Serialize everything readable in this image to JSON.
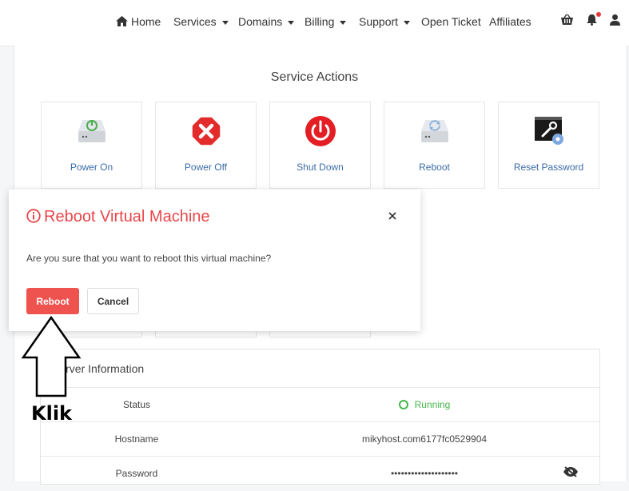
{
  "nav": {
    "home": "Home",
    "services": "Services",
    "domains": "Domains",
    "billing": "Billing",
    "support": "Support",
    "open_ticket": "Open Ticket",
    "affiliates": "Affiliates",
    "icons": [
      "home-icon",
      "basket-icon",
      "bell-icon",
      "user-icon"
    ]
  },
  "service_actions": {
    "title": "Service Actions",
    "items": [
      {
        "label": "Power On",
        "icon": "power-on-icon"
      },
      {
        "label": "Power Off",
        "icon": "power-off-icon"
      },
      {
        "label": "Shut Down",
        "icon": "shutdown-icon"
      },
      {
        "label": "Reboot",
        "icon": "reboot-icon"
      },
      {
        "label": "Reset Password",
        "icon": "reset-password-icon"
      }
    ]
  },
  "modal": {
    "title": "Reboot Virtual Machine",
    "message": "Are you sure that you want to reboot this virtual machine?",
    "confirm_label": "Reboot",
    "cancel_label": "Cancel"
  },
  "server_info": {
    "title": "Server Information",
    "rows": [
      {
        "key": "Status",
        "value": "Running"
      },
      {
        "key": "Hostname",
        "value": "mikyhost.com6177fc0529904"
      },
      {
        "key": "Password",
        "value": "••••••••••••••••••••"
      }
    ]
  },
  "annotation": {
    "label": "Klik"
  },
  "colors": {
    "accent_red": "#e8474a",
    "button_red": "#ef5350",
    "link_blue": "#3b6ca8",
    "running_green": "#45b649"
  }
}
